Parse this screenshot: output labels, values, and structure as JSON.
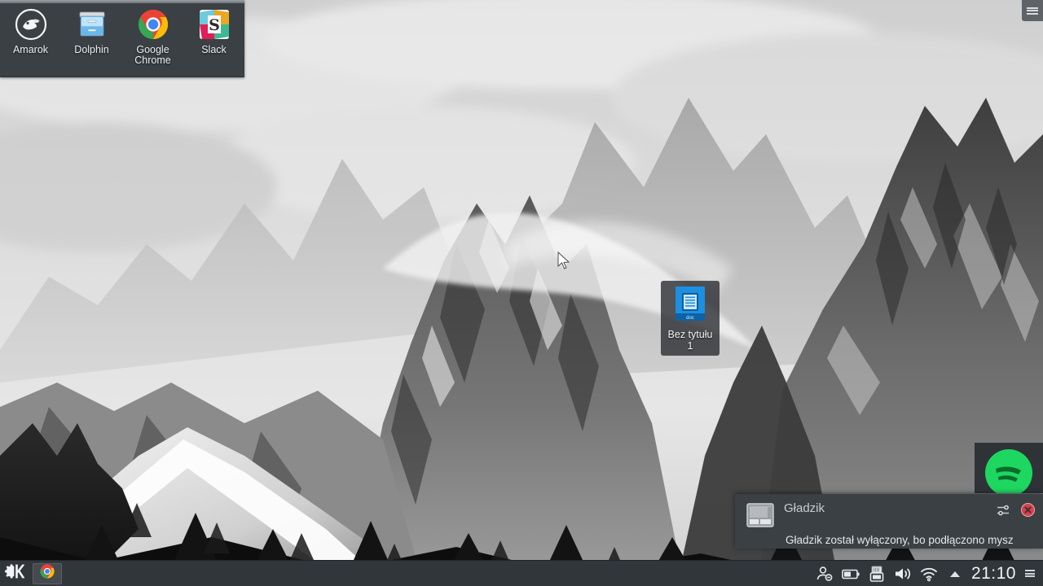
{
  "desktop": {
    "wallpaper_name": "grayscale-mountain-photo",
    "wallpaper_colors": {
      "sky": "#d8d8d8",
      "mid": "#9a9a9a",
      "rock": "#4a4a4a",
      "dark": "#1c1c1c"
    }
  },
  "launcher": {
    "background": "#3b4045",
    "items": [
      {
        "label": "Amarok",
        "icon": "amarok-icon"
      },
      {
        "label": "Dolphin",
        "icon": "dolphin-icon"
      },
      {
        "label": "Google Chrome",
        "icon": "google-chrome-icon"
      },
      {
        "label": "Slack",
        "icon": "slack-icon"
      }
    ]
  },
  "toolbox": {
    "icon": "hamburger-icon",
    "label": ""
  },
  "desktop_icon": {
    "name_line1": "Bez tytułu",
    "name_line2": "1",
    "badge": "doc",
    "icon": "document-icon",
    "color": "#1d8fe0"
  },
  "tray_popup": {
    "icon": "spotify-icon",
    "color": "#1ed760"
  },
  "notification": {
    "title": "Gładzik",
    "body": "Gładzik został wyłączony, bo podłączono mysz",
    "icon": "touchpad-icon",
    "configure_icon": "settings-sliders-icon",
    "close_icon": "close-icon",
    "close_color": "#d1434d",
    "background": "#3b4045"
  },
  "taskbar": {
    "background": "#31363b",
    "menu": {
      "icon": "kde-k-logo-icon",
      "label": ""
    },
    "tasks": [
      {
        "icon": "google-chrome-icon",
        "label": ""
      }
    ],
    "tray": [
      {
        "icon": "user-status-icon",
        "label": ""
      },
      {
        "icon": "battery-icon",
        "label": ""
      },
      {
        "icon": "usb-device-icon",
        "label": ""
      },
      {
        "icon": "volume-icon",
        "label": ""
      },
      {
        "icon": "wifi-icon",
        "label": ""
      },
      {
        "icon": "chevron-up-icon",
        "label": ""
      }
    ],
    "clock": "21:10",
    "toggle_icon": "hamburger-icon"
  }
}
